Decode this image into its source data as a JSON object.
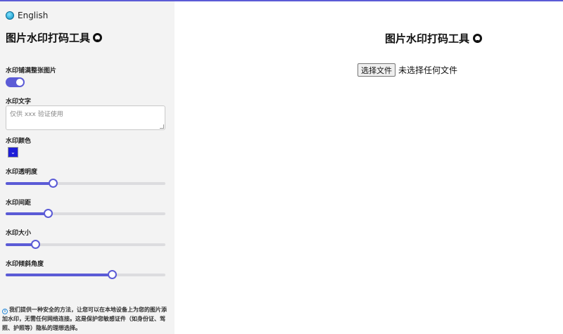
{
  "sidebar": {
    "language": "English",
    "title": "图片水印打码工具",
    "fill_label": "水印铺满整张图片",
    "fill_enabled": true,
    "text_label": "水印文字",
    "text_placeholder": "仅供 xxx 验证使用",
    "color_label": "水印颜色",
    "color_value": "#1e1ed8",
    "sliders": [
      {
        "label": "水印透明度",
        "value": 0.3
      },
      {
        "label": "水印间距",
        "value": 0.27
      },
      {
        "label": "水印大小",
        "value": 0.19
      },
      {
        "label": "水印倾斜角度",
        "value": 0.67
      }
    ],
    "info": "我们提供一种安全的方法，让您可以在本地设备上为您的图片添加水印，无需任何网络连接。这是保护您敏感证件（如身份证、驾照、护照等）隐私的理想选择。"
  },
  "main": {
    "title": "图片水印打码工具",
    "file_button": "选择文件",
    "file_status": "未选择任何文件"
  },
  "colors": {
    "accent": "#5b5bd6",
    "sidebar_bg": "#f3f3f3"
  }
}
